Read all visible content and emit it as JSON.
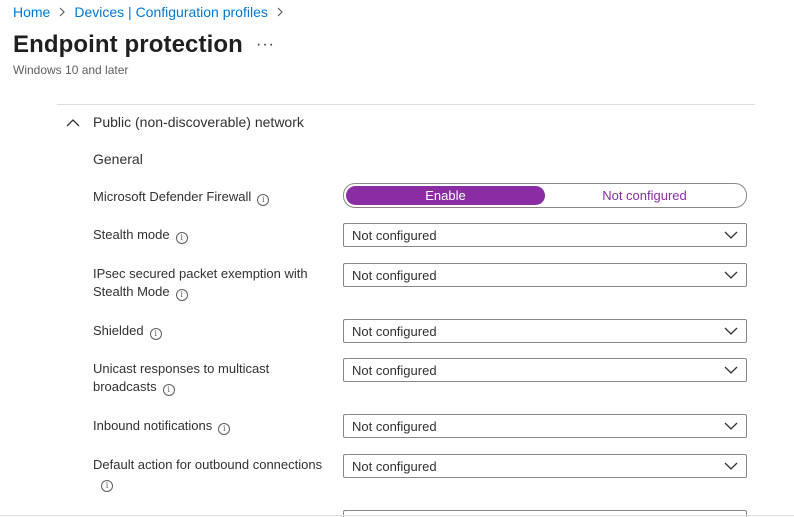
{
  "breadcrumb": {
    "items": [
      "Home",
      "Devices | Configuration profiles"
    ]
  },
  "page": {
    "title": "Endpoint protection",
    "more_label": "···",
    "subtitle": "Windows 10 and later"
  },
  "section": {
    "title": "Public (non-discoverable) network",
    "expanded": true,
    "group_label": "General"
  },
  "settings": {
    "firewall": {
      "label": "Microsoft Defender Firewall",
      "options": [
        "Enable",
        "Not configured"
      ],
      "selected": "Enable"
    },
    "stealth_mode": {
      "label": "Stealth mode",
      "value": "Not configured"
    },
    "ipsec": {
      "label_line1": "IPsec secured packet exemption with",
      "label_line2": "Stealth Mode",
      "value": "Not configured"
    },
    "shielded": {
      "label": "Shielded",
      "value": "Not configured"
    },
    "unicast": {
      "label_line1": "Unicast responses to multicast",
      "label_line2": "broadcasts",
      "value": "Not configured"
    },
    "inbound": {
      "label": "Inbound notifications",
      "value": "Not configured"
    },
    "outbound": {
      "label": "Default action for outbound connections",
      "value": "Not configured"
    }
  },
  "colors": {
    "link": "#0078d4",
    "toggle_accent": "#8a2da5"
  },
  "icons": {
    "breadcrumb_separator": "chevron-right-icon",
    "section_toggle": "chevron-up-icon",
    "info": "info-icon",
    "dropdown": "chevron-down-icon"
  }
}
